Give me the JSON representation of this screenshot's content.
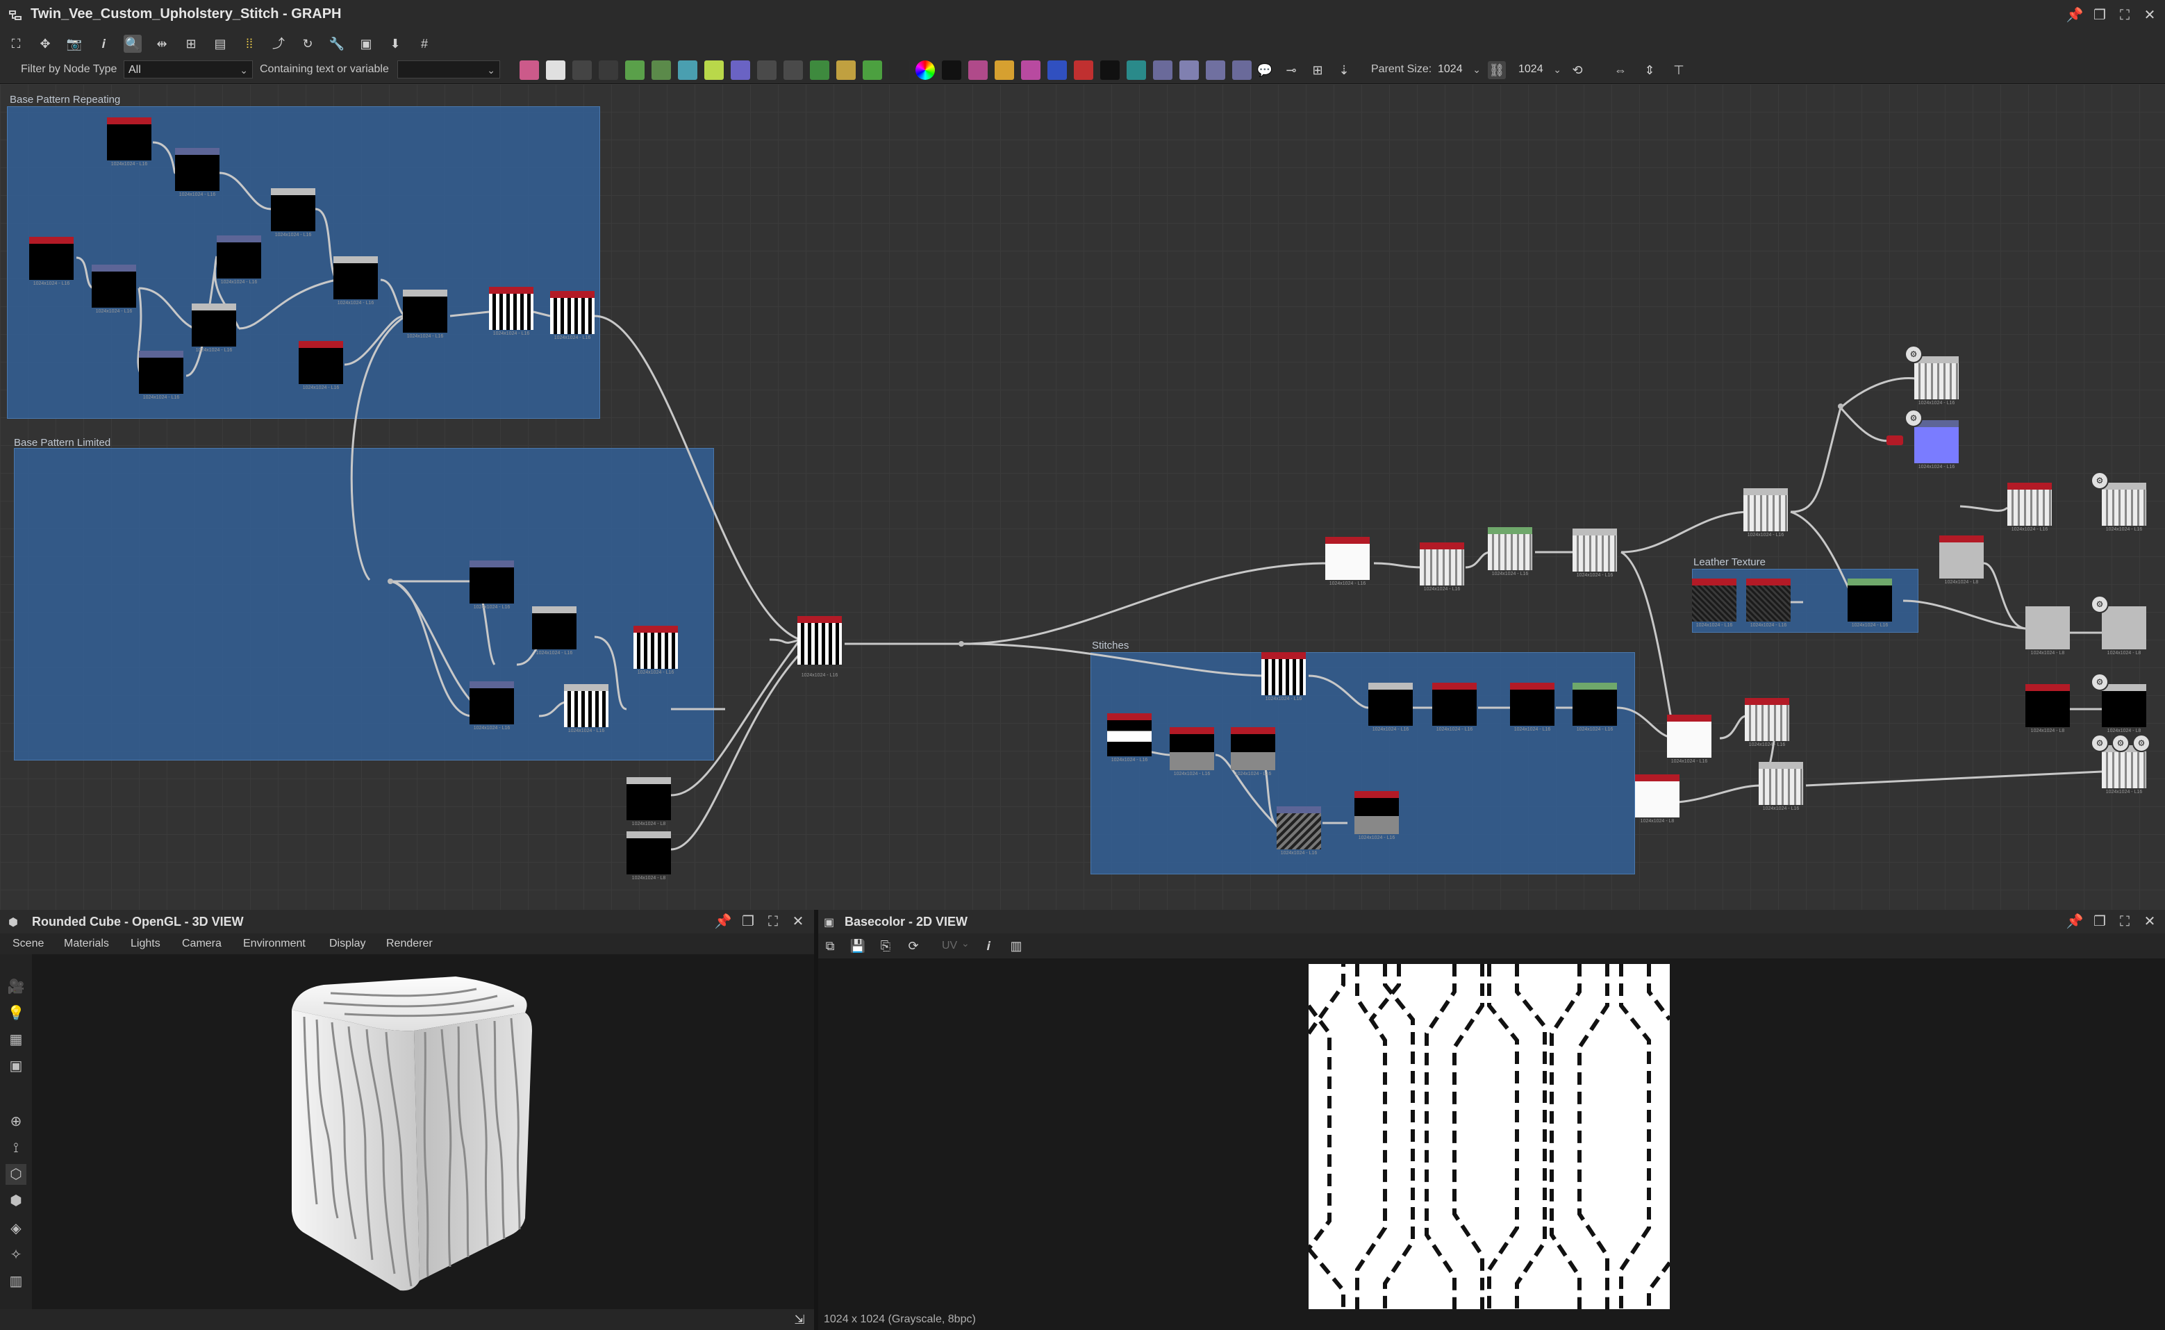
{
  "window": {
    "title": "Twin_Vee_Custom_Upholstery_Stitch - GRAPH",
    "app_icon": "graph-icon"
  },
  "filter": {
    "label": "Filter by Node Type",
    "value": "All",
    "text_label": "Containing text or variable",
    "text_value": ""
  },
  "parent_size": {
    "label": "Parent Size:",
    "width": "1024",
    "height": "1024"
  },
  "frames": {
    "base_repeating": "Base Pattern Repeating",
    "base_limited": "Base Pattern Limited",
    "stitches": "Stitches",
    "leather": "Leather Texture"
  },
  "node_caption": "1024x1024 - L16",
  "node_caption_l8": "1024x1024 - L8",
  "view3d": {
    "title": "Rounded Cube - OpenGL - 3D VIEW",
    "menu": [
      "Scene",
      "Materials",
      "Lights",
      "Camera",
      "Environment",
      "Display",
      "Renderer"
    ]
  },
  "view2d": {
    "title": "Basecolor - 2D VIEW",
    "uv_label": "UV",
    "status": "1024 x 1024 (Grayscale, 8bpc)"
  },
  "colors": {
    "accent_red": "#b31a26",
    "frame_blue": "#34609a",
    "header_purple": "#5d6597",
    "header_green": "#6fa86b"
  }
}
